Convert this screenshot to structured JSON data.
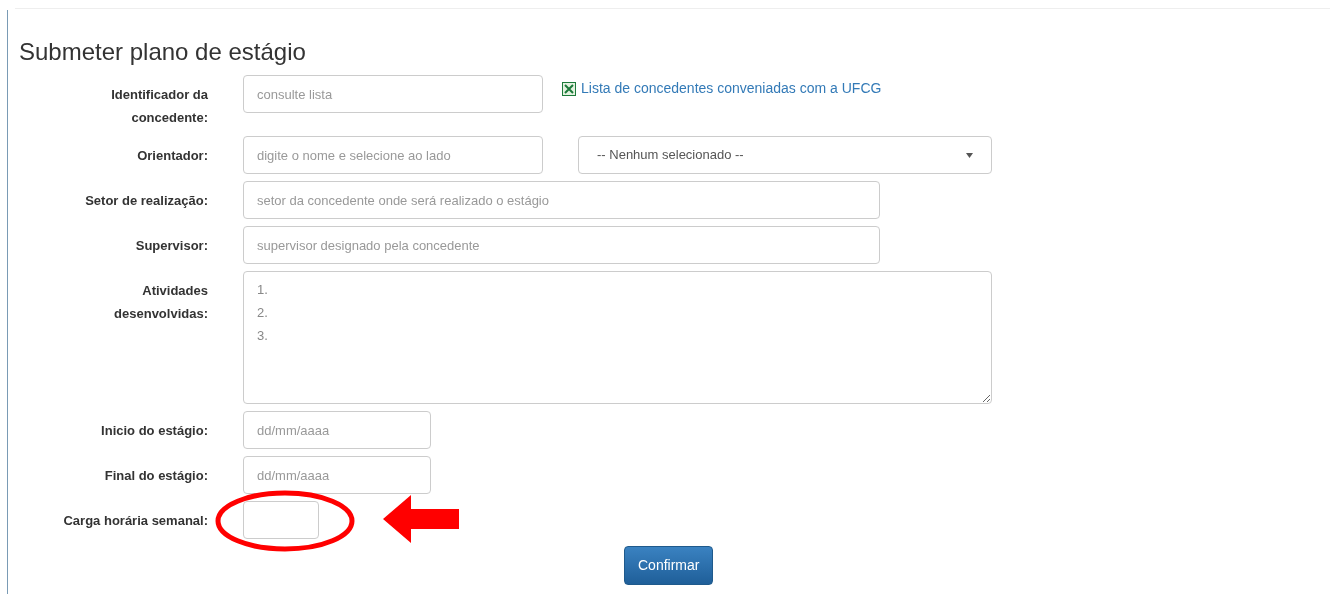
{
  "title": "Submeter plano de estágio",
  "fields": [
    {
      "kind": "input",
      "label": "Identificador da concedente:",
      "placeholder": "consulte lista",
      "link": "Lista de concedentes conveniadas com a UFCG"
    },
    {
      "kind": "input",
      "label": "Orientador:",
      "placeholder": "digite o nome e selecione ao lado",
      "select": "-- Nenhum selecionado --"
    },
    {
      "kind": "input",
      "label": "Setor de realização:",
      "placeholder": "setor da concedente onde será realizado o estágio"
    },
    {
      "kind": "input",
      "label": "Supervisor:",
      "placeholder": "supervisor designado pela concedente"
    },
    {
      "kind": "textarea",
      "label": "Atividades desenvolvidas:",
      "placeholder": "1.\n2.\n3."
    },
    {
      "kind": "input",
      "label": "Inicio do estágio:",
      "placeholder": "dd/mm/aaaa"
    },
    {
      "kind": "input",
      "label": "Final do estágio:",
      "placeholder": "dd/mm/aaaa"
    },
    {
      "kind": "input",
      "label": "Carga horária semanal:",
      "annotations": [
        {
          "kind": "ellipse"
        },
        {
          "kind": "arrow"
        }
      ]
    }
  ],
  "submit": "Confirmar"
}
